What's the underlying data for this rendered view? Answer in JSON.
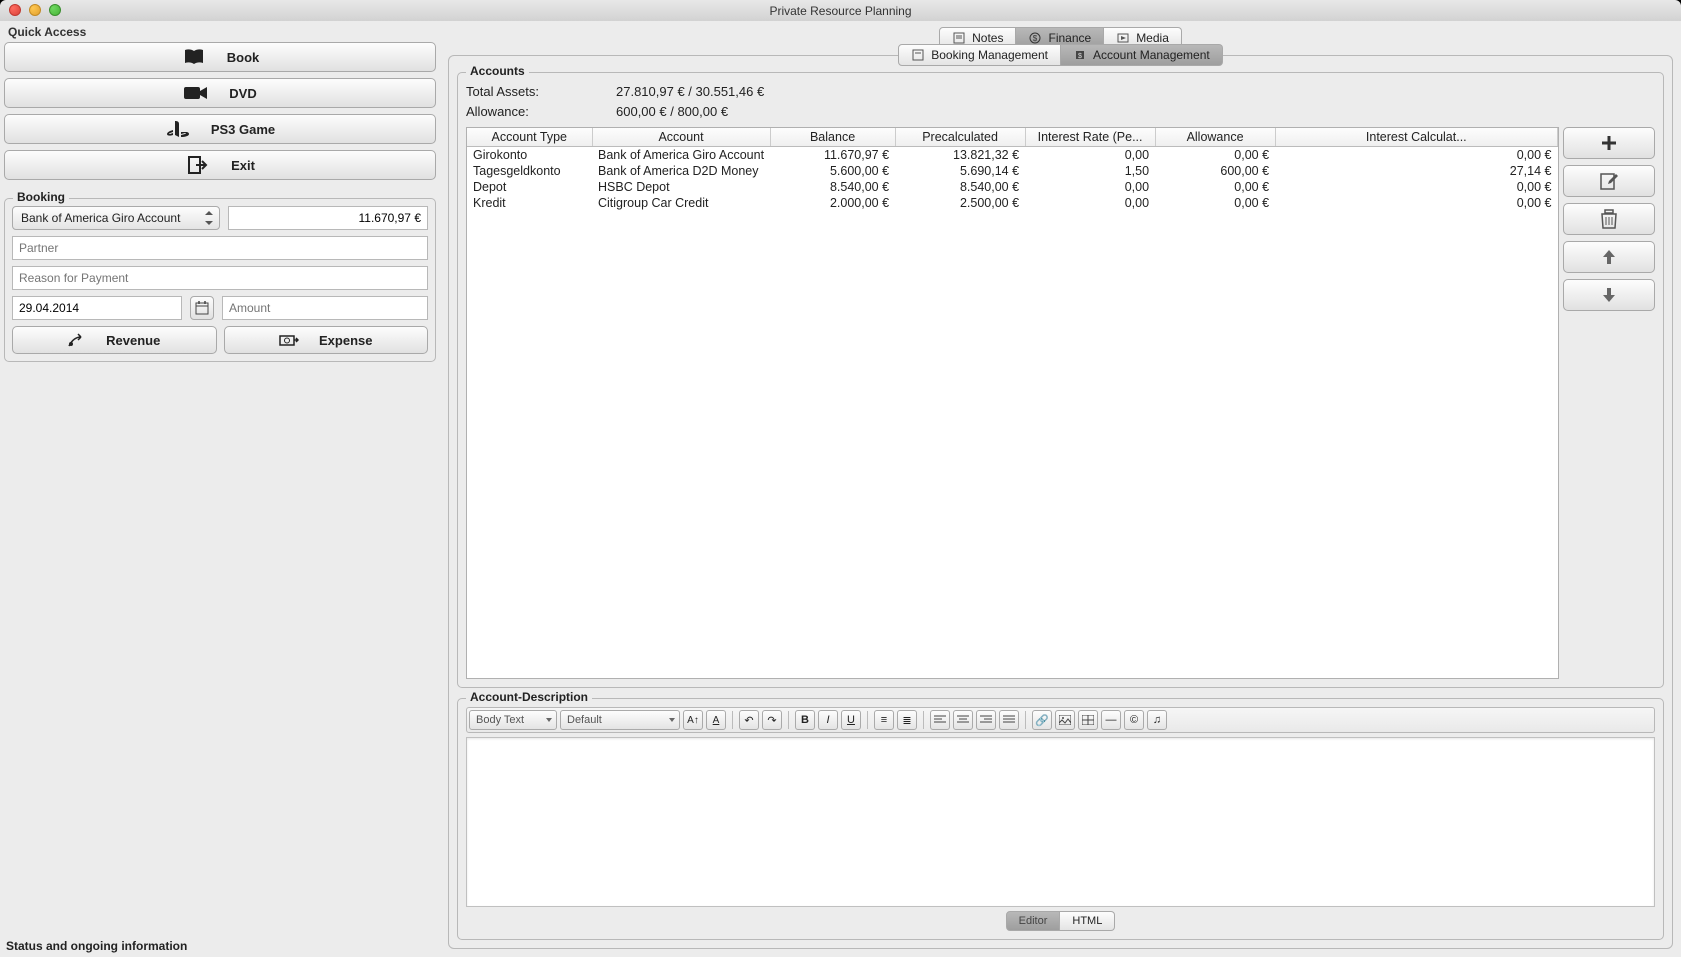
{
  "window": {
    "title": "Private Resource Planning"
  },
  "quick_access": {
    "label": "Quick Access",
    "buttons": {
      "book": "Book",
      "dvd": "DVD",
      "ps3": "PS3 Game",
      "exit": "Exit"
    }
  },
  "booking": {
    "label": "Booking",
    "account_selected": "Bank of America Giro Account",
    "balance_display": "11.670,97 €",
    "partner_placeholder": "Partner",
    "reason_placeholder": "Reason for Payment",
    "date_value": "29.04.2014",
    "amount_placeholder": "Amount",
    "revenue_label": "Revenue",
    "expense_label": "Expense"
  },
  "tabs_top": {
    "notes": "Notes",
    "finance": "Finance",
    "media": "Media"
  },
  "tabs_sub": {
    "booking_mgmt": "Booking Management",
    "account_mgmt": "Account Management"
  },
  "accounts": {
    "label": "Accounts",
    "total_assets_label": "Total Assets:",
    "total_assets_value": "27.810,97 €  /  30.551,46 €",
    "allowance_label": "Allowance:",
    "allowance_value": "600,00 €  /  800,00 €",
    "columns": {
      "type": "Account Type",
      "account": "Account",
      "balance": "Balance",
      "precalc": "Precalculated",
      "interest_rate": "Interest Rate (Pe...",
      "allowance": "Allowance",
      "interest_calc": "Interest Calculat..."
    },
    "rows": [
      {
        "type": "Girokonto",
        "account": "Bank of America Giro Account",
        "balance": "11.670,97 €",
        "precalc": "13.821,32 €",
        "rate": "0,00",
        "allowance": "0,00 €",
        "calc": "0,00 €"
      },
      {
        "type": "Tagesgeldkonto",
        "account": "Bank of America D2D Money",
        "balance": "5.600,00 €",
        "precalc": "5.690,14 €",
        "rate": "1,50",
        "allowance": "600,00 €",
        "calc": "27,14 €"
      },
      {
        "type": "Depot",
        "account": "HSBC Depot",
        "balance": "8.540,00 €",
        "precalc": "8.540,00 €",
        "rate": "0,00",
        "allowance": "0,00 €",
        "calc": "0,00 €"
      },
      {
        "type": "Kredit",
        "account": "Citigroup Car Credit",
        "balance": "2.000,00 €",
        "precalc": "2.500,00 €",
        "rate": "0,00",
        "allowance": "0,00 €",
        "calc": "0,00 €"
      }
    ]
  },
  "description": {
    "label": "Account-Description",
    "style_select": "Body Text",
    "font_select": "Default",
    "editor_tab": "Editor",
    "html_tab": "HTML"
  },
  "status": "Status and ongoing information"
}
